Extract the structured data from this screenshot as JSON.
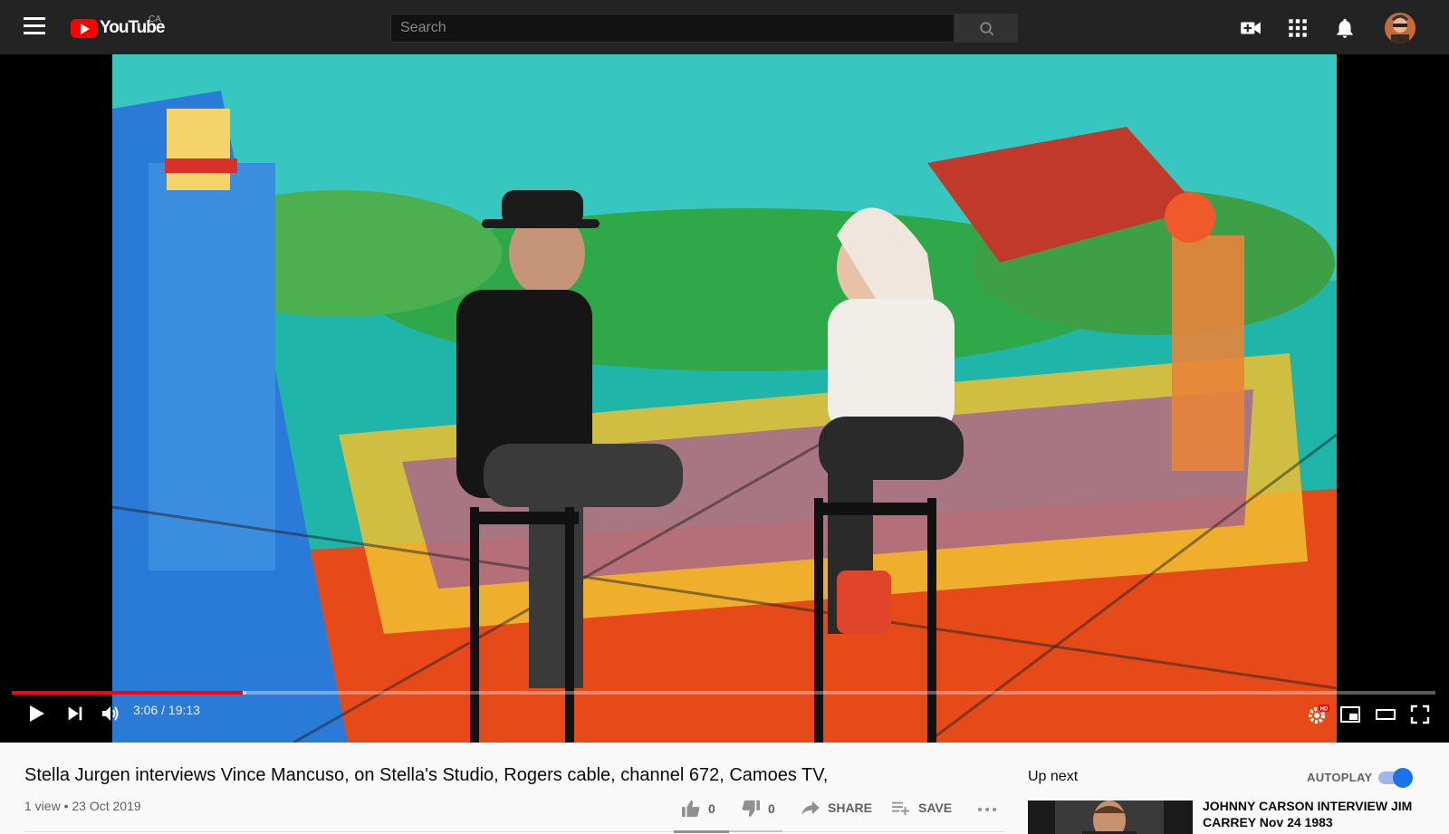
{
  "header": {
    "logo_text": "YouTube",
    "region": "CA",
    "search_placeholder": "Search"
  },
  "player": {
    "time_display": "3:06 / 19:13",
    "progress_fraction": 0.162,
    "loaded_fraction": 0.165,
    "hd_badge": "HD",
    "accent_color": "#ff0000"
  },
  "video": {
    "title": "Stella Jurgen interviews Vince Mancuso, on Stella's Studio, Rogers cable, channel 672, Camoes TV,",
    "views": "1 view",
    "date": "23 Oct 2019",
    "likes": "0",
    "dislikes": "0",
    "share_label": "SHARE",
    "save_label": "SAVE"
  },
  "sidebar": {
    "up_next": "Up next",
    "autoplay_label": "AUTOPLAY",
    "autoplay_on": true,
    "recommendations": [
      {
        "title": "JOHNNY CARSON INTERVIEW JIM CARREY Nov 24 1983"
      }
    ]
  }
}
